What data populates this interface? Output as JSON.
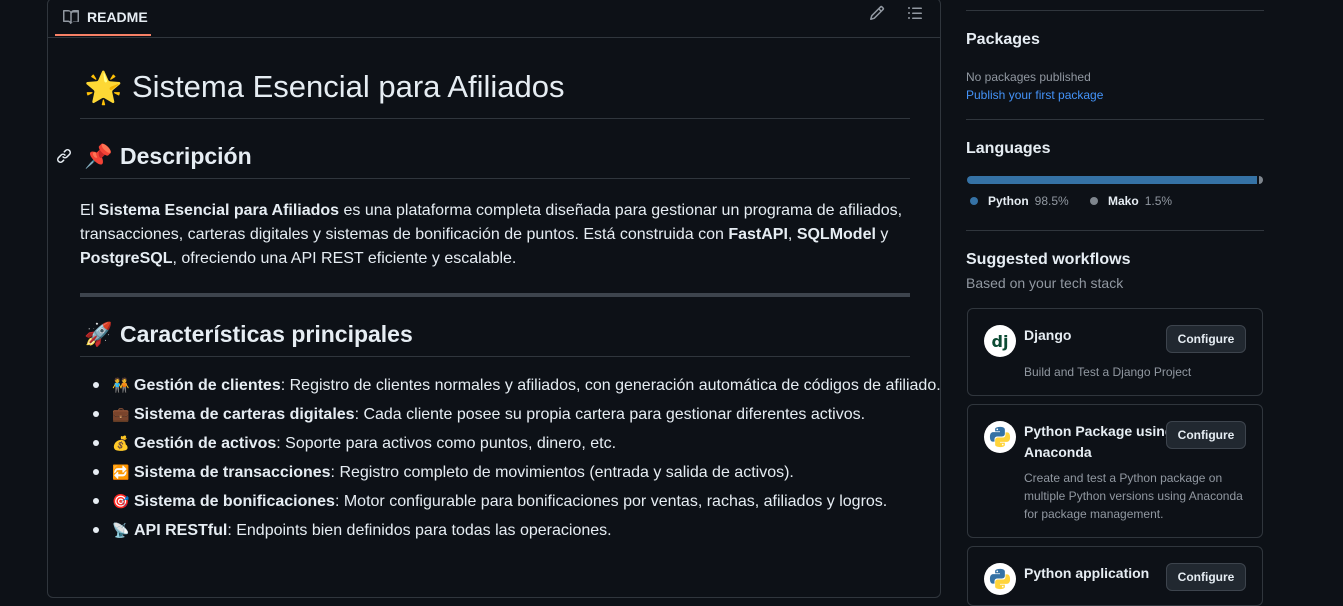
{
  "readme": {
    "tab_label": "README",
    "title_emoji": "🌟",
    "title": "Sistema Esencial para Afiliados",
    "section1": {
      "emoji": "📌",
      "heading": "Descripción",
      "text_before": "El ",
      "bold_name": "Sistema Esencial para Afiliados",
      "text_mid": " es una plataforma completa diseñada para gestionar un programa de afiliados, transacciones, carteras digitales y sistemas de bonificación de puntos. Está construida con ",
      "fastapi": "FastAPI",
      "comma": ", ",
      "sqlmodel": "SQLModel",
      "and": " y ",
      "postgres": "PostgreSQL",
      "text_end": ", ofreciendo una API REST eficiente y escalable."
    },
    "section2": {
      "emoji": "🚀",
      "heading": "Características principales",
      "features": [
        {
          "icon": "🧑‍🤝‍🧑",
          "bold": "Gestión de clientes",
          "text": ": Registro de clientes normales y afiliados, con generación automática de códigos de afiliado."
        },
        {
          "icon": "💼",
          "bold": "Sistema de carteras digitales",
          "text": ": Cada cliente posee su propia cartera para gestionar diferentes activos."
        },
        {
          "icon": "💰",
          "bold": "Gestión de activos",
          "text": ": Soporte para activos como puntos, dinero, etc."
        },
        {
          "icon": "🔁",
          "bold": "Sistema de transacciones",
          "text": ": Registro completo de movimientos (entrada y salida de activos)."
        },
        {
          "icon": "🎯",
          "bold": "Sistema de bonificaciones",
          "text": ": Motor configurable para bonificaciones por ventas, rachas, afiliados y logros."
        },
        {
          "icon": "📡",
          "bold": "API RESTful",
          "text": ": Endpoints bien definidos para todas las operaciones."
        }
      ]
    }
  },
  "sidebar": {
    "packages": {
      "heading": "Packages",
      "empty_text": "No packages published",
      "link": "Publish your first package"
    },
    "languages": {
      "heading": "Languages",
      "items": [
        {
          "name": "Python",
          "percent": "98.5%",
          "value": 98.5,
          "color": "#3572A5"
        },
        {
          "name": "Mako",
          "percent": "1.5%",
          "value": 1.5,
          "color": "#7e858d"
        }
      ]
    },
    "workflows": {
      "heading": "Suggested workflows",
      "subheading": "Based on your tech stack",
      "items": [
        {
          "title": "Django",
          "desc": "Build and Test a Django Project",
          "button": "Configure",
          "logo": "django-logo"
        },
        {
          "title": "Python Package using Anaconda",
          "desc": "Create and test a Python package on multiple Python versions using Anaconda for package management.",
          "button": "Configure",
          "logo": "python-logo"
        },
        {
          "title": "Python application",
          "desc": "",
          "button": "Configure",
          "logo": "python-logo"
        }
      ]
    }
  }
}
